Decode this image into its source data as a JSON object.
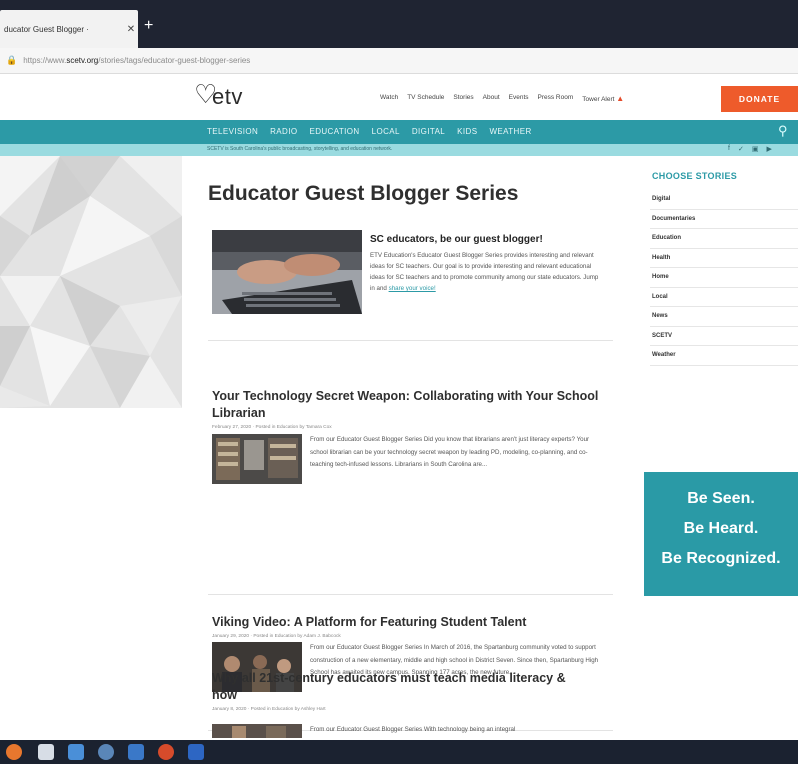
{
  "browser": {
    "tab_title": "ducator Guest Blogger ·",
    "tab_close": "✕",
    "new_tab": "+",
    "url_prefix": "https://www.",
    "url_domain": "scetv.org",
    "url_path": "/stories/tags/educator-guest-blogger-series"
  },
  "header": {
    "logo": "etv",
    "nav": [
      "Watch",
      "TV Schedule",
      "Stories",
      "About",
      "Events",
      "Press Room",
      "Tower Alert"
    ],
    "donate": "DONATE"
  },
  "mainnav": {
    "items": [
      "TELEVISION",
      "RADIO",
      "EDUCATION",
      "LOCAL",
      "DIGITAL",
      "KIDS",
      "WEATHER"
    ]
  },
  "tagline": "SCETV is South Carolina's public broadcasting, storytelling, and education network.",
  "page": {
    "title": "Educator Guest Blogger Series",
    "intro_title": "SC educators, be our guest blogger!",
    "intro_text": "ETV Education's Educator Guest Blogger Series provides interesting and relevant ideas for SC teachers. Our goal is to provide interesting and relevant educational ideas for SC teachers and to promote community among our state educators. Jump in and",
    "intro_link": "share your voice!"
  },
  "posts": [
    {
      "title": "Your Technology Secret Weapon: Collaborating with Your School Librarian",
      "meta": "February 27, 2020 · Posted in Education by Tamara Cox",
      "excerpt": "From our Educator Guest Blogger Series Did you know that librarians aren't just literacy experts? Your school librarian can be your technology secret weapon by leading PD, modeling, co-planning, and co-teaching tech-infused lessons. Librarians in South Carolina are..."
    },
    {
      "title": "Viking Video: A Platform for Featuring Student Talent",
      "meta": "January 29, 2020 · Posted in Education by Adam J. Babcock",
      "excerpt": "From our Educator Guest Blogger Series In March of 2016, the Spartanburg community voted to support construction of a new elementary, middle and high school in District Seven. Since then, Spartanburg High School has awaited its new campus. Spanning 177 acres, the new future..."
    },
    {
      "title": "Why all 21st-century educators must teach media literacy & how",
      "meta": "January 8, 2020 · Posted in Education by Ashley Hart",
      "excerpt": "From our Educator Guest Blogger Series With technology being an integral"
    }
  ],
  "sidebar": {
    "title": "CHOOSE STORIES",
    "items": [
      "Digital",
      "Documentaries",
      "Education",
      "Health",
      "Home",
      "Local",
      "News",
      "SCETV",
      "Weather"
    ]
  },
  "ad": {
    "line1": "Be Seen.",
    "line2": "Be Heard.",
    "line3": "Be Recognized."
  },
  "colors": {
    "teal": "#2c9aa6",
    "donate": "#ee5b2b",
    "tagline_bg": "#9adbe0"
  }
}
